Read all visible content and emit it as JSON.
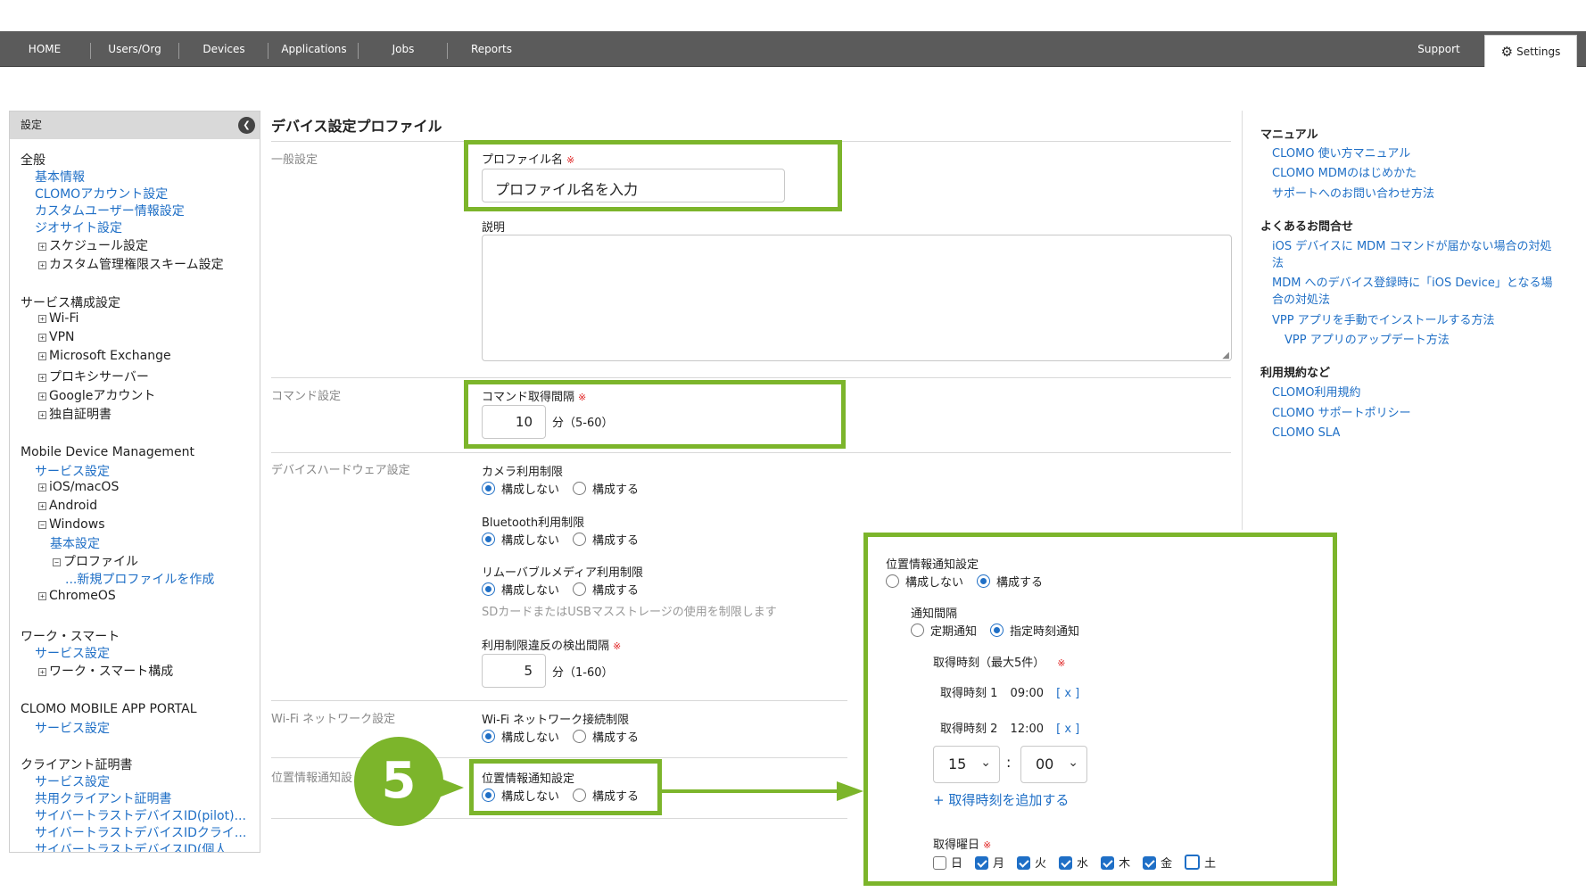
{
  "nav": {
    "items": [
      "HOME",
      "Users/Org",
      "Devices",
      "Applications",
      "Jobs",
      "Reports"
    ],
    "support": "Support",
    "settings": "Settings"
  },
  "sidebar": {
    "header": "設定",
    "general": {
      "title": "全般",
      "items": [
        "基本情報",
        "CLOMOアカウント設定",
        "カスタムユーザー情報設定",
        "ジオサイト設定"
      ],
      "expandables": [
        "スケジュール設定",
        "カスタム管理権限スキーム設定"
      ]
    },
    "service_config": {
      "title": "サービス構成設定",
      "expandables": [
        "Wi-Fi",
        "VPN",
        "Microsoft Exchange",
        "プロキシサーバー",
        "Googleアカウント",
        "独自証明書"
      ]
    },
    "mdm": {
      "title": "Mobile Device Management",
      "service": "サービス設定",
      "ios": "iOS/macOS",
      "android": "Android",
      "windows": "Windows",
      "windows_basic": "基本設定",
      "windows_profile": "プロファイル",
      "windows_new_profile": "...新規プロファイルを作成",
      "chromeos": "ChromeOS"
    },
    "work_smart": {
      "title": "ワーク・スマート",
      "service": "サービス設定",
      "config": "ワーク・スマート構成"
    },
    "portal": {
      "title": "CLOMO MOBILE APP PORTAL",
      "service": "サービス設定"
    },
    "client_cert": {
      "title": "クライアント証明書",
      "items": [
        "サービス設定",
        "共用クライアント証明書",
        "サイバートラストデバイスID(pilot)...",
        "サイバートラストデバイスIDクライ...",
        "サイバートラストデバイスID(個人..."
      ]
    }
  },
  "main": {
    "title": "デバイス設定プロファイル",
    "sections": {
      "general": "一般設定",
      "command": "コマンド設定",
      "hardware": "デバイスハードウェア設定",
      "wifi": "Wi-Fi ネットワーク設定",
      "location": "位置情報通知設"
    },
    "profile_name_label": "プロファイル名",
    "required_mark": "※",
    "profile_name_placeholder": "プロファイル名を入力",
    "description_label": "説明",
    "command_interval_label": "コマンド取得間隔",
    "command_interval_value": "10",
    "command_interval_unit": "分（5-60）",
    "camera_label": "カメラ利用制限",
    "bluetooth_label": "Bluetooth利用制限",
    "removable_label": "リムーバブルメディア利用制限",
    "removable_hint": "SDカードまたはUSBマスストレージの使用を制限します",
    "violation_label": "利用制限違反の検出間隔",
    "violation_value": "5",
    "violation_unit": "分（1-60）",
    "wifi_label": "Wi-Fi ネットワーク接続制限",
    "location_label": "位置情報通知設定",
    "opt_off": "構成しない",
    "opt_on": "構成する"
  },
  "help": {
    "manual_title": "マニュアル",
    "manual_links": [
      "CLOMO 使い方マニュアル",
      "CLOMO MDMのはじめかた",
      "サポートへのお問い合わせ方法"
    ],
    "faq_title": "よくあるお問合せ",
    "faq_links": [
      "iOS デバイスに MDM コマンドが届かない場合の対処法",
      "MDM へのデバイス登録時に「iOS Device」となる場合の対処法",
      "VPP アプリを手動でインストールする方法",
      "VPP アプリのアップデート方法"
    ],
    "terms_title": "利用規約など",
    "terms_links": [
      "CLOMO利用規約",
      "CLOMO サポートポリシー",
      "CLOMO SLA"
    ]
  },
  "zoom": {
    "title": "位置情報通知設定",
    "opt_off": "構成しない",
    "opt_on": "構成する",
    "interval_label": "通知間隔",
    "periodic": "定期通知",
    "scheduled": "指定時刻通知",
    "times_label": "取得時刻（最大5件）",
    "required_mark": "※",
    "time1_label": "取得時刻 1",
    "time1_value": "09:00",
    "time2_label": "取得時刻 2",
    "time2_value": "12:00",
    "remove": "[ x ]",
    "hour_value": "15",
    "colon": ":",
    "minute_value": "00",
    "add_time": "+ 取得時刻を追加する",
    "days_label": "取得曜日",
    "days": [
      "日",
      "月",
      "火",
      "水",
      "木",
      "金",
      "土"
    ],
    "days_checked": [
      false,
      true,
      true,
      true,
      true,
      true,
      false
    ]
  },
  "step": "5",
  "colors": {
    "accent_green": "#7cb52b",
    "link_blue": "#1f6fc6",
    "nav_bg": "#5b5b5b",
    "required_red": "#e02020"
  }
}
